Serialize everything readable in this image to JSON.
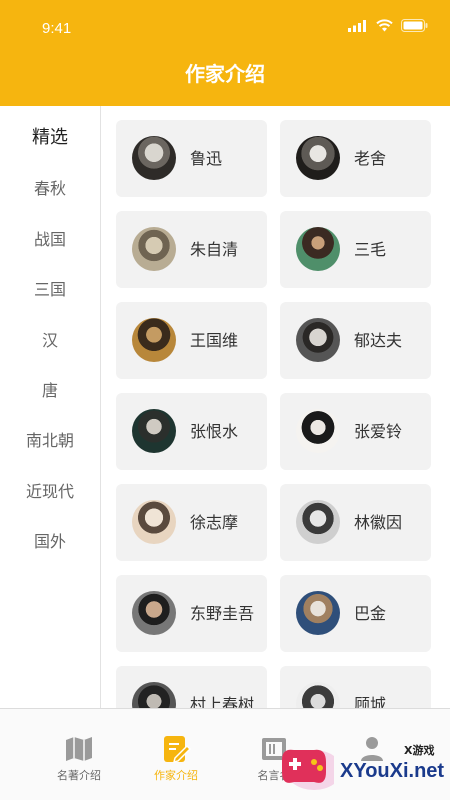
{
  "status_bar": {
    "time": "9:41"
  },
  "header": {
    "title": "作家介绍"
  },
  "sidebar": {
    "items": [
      {
        "label": "精选",
        "active": true
      },
      {
        "label": "春秋"
      },
      {
        "label": "战国"
      },
      {
        "label": "三国"
      },
      {
        "label": "汉"
      },
      {
        "label": "唐"
      },
      {
        "label": "南北朝"
      },
      {
        "label": "近现代"
      },
      {
        "label": "国外"
      }
    ]
  },
  "authors": [
    {
      "name": "鲁迅"
    },
    {
      "name": "老舍"
    },
    {
      "name": "朱自清"
    },
    {
      "name": "三毛"
    },
    {
      "name": "王国维"
    },
    {
      "name": "郁达夫"
    },
    {
      "name": "张恨水"
    },
    {
      "name": "张爱铃"
    },
    {
      "name": "徐志摩"
    },
    {
      "name": "林徽因"
    },
    {
      "name": "东野圭吾"
    },
    {
      "name": "巴金"
    },
    {
      "name": "村上春树"
    },
    {
      "name": "顾城"
    }
  ],
  "tabbar": {
    "tabs": [
      {
        "label": "名著介绍",
        "icon": "map-icon"
      },
      {
        "label": "作家介绍",
        "icon": "edit-icon",
        "active": true
      },
      {
        "label": "名言名",
        "icon": "scroll-icon"
      },
      {
        "label": "",
        "icon": "person-icon"
      }
    ]
  },
  "watermark": {
    "small": "X游戏",
    "big": "XYouXi.net"
  },
  "colors": {
    "accent": "#f6b50f",
    "card_bg": "#f2f2f2",
    "tab_inactive": "#9a9a9a"
  }
}
